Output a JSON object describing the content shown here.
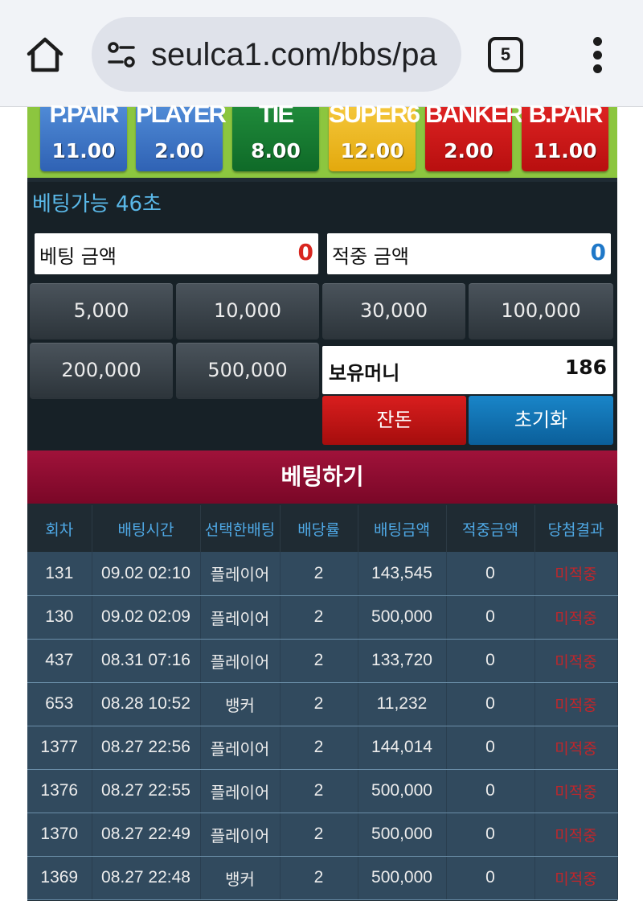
{
  "browser": {
    "url": "seulca1.com/bbs/pa",
    "tab_count": "5"
  },
  "bet_options": [
    {
      "name": "P.PAIR",
      "odds": "11.00",
      "color": "#3b74c8"
    },
    {
      "name": "PLAYER",
      "odds": "2.00",
      "color": "#3b74c8"
    },
    {
      "name": "TIE",
      "odds": "8.00",
      "color": "#177a30"
    },
    {
      "name": "SUPER6",
      "odds": "12.00",
      "color": "#eab520"
    },
    {
      "name": "BANKER",
      "odds": "2.00",
      "color": "#c81414"
    },
    {
      "name": "B.PAIR",
      "odds": "11.00",
      "color": "#c81414"
    }
  ],
  "betting": {
    "timer_text": "베팅가능 46초",
    "bet_amount_label": "베팅 금액",
    "bet_amount_value": "0",
    "win_amount_label": "적중 금액",
    "win_amount_value": "0",
    "chips": [
      "5,000",
      "10,000",
      "30,000",
      "100,000",
      "200,000",
      "500,000"
    ],
    "holdings_label": "보유머니",
    "holdings_value": "186",
    "change_label": "잔돈",
    "reset_label": "초기화",
    "place_bet_label": "베팅하기"
  },
  "history": {
    "headers": [
      "회차",
      "배팅시간",
      "선택한배팅",
      "배당률",
      "배팅금액",
      "적중금액",
      "당첨결과"
    ],
    "rows": [
      {
        "round": "131",
        "time": "09.02 02:10",
        "pick": "플레이어",
        "odds": "2",
        "bet": "143,545",
        "win": "0",
        "result": "미적중"
      },
      {
        "round": "130",
        "time": "09.02 02:09",
        "pick": "플레이어",
        "odds": "2",
        "bet": "500,000",
        "win": "0",
        "result": "미적중"
      },
      {
        "round": "437",
        "time": "08.31 07:16",
        "pick": "플레이어",
        "odds": "2",
        "bet": "133,720",
        "win": "0",
        "result": "미적중"
      },
      {
        "round": "653",
        "time": "08.28 10:52",
        "pick": "뱅커",
        "odds": "2",
        "bet": "11,232",
        "win": "0",
        "result": "미적중"
      },
      {
        "round": "1377",
        "time": "08.27 22:56",
        "pick": "플레이어",
        "odds": "2",
        "bet": "144,014",
        "win": "0",
        "result": "미적중"
      },
      {
        "round": "1376",
        "time": "08.27 22:55",
        "pick": "플레이어",
        "odds": "2",
        "bet": "500,000",
        "win": "0",
        "result": "미적중"
      },
      {
        "round": "1370",
        "time": "08.27 22:49",
        "pick": "플레이어",
        "odds": "2",
        "bet": "500,000",
        "win": "0",
        "result": "미적중"
      },
      {
        "round": "1369",
        "time": "08.27 22:48",
        "pick": "뱅커",
        "odds": "2",
        "bet": "500,000",
        "win": "0",
        "result": "미적중"
      }
    ]
  }
}
